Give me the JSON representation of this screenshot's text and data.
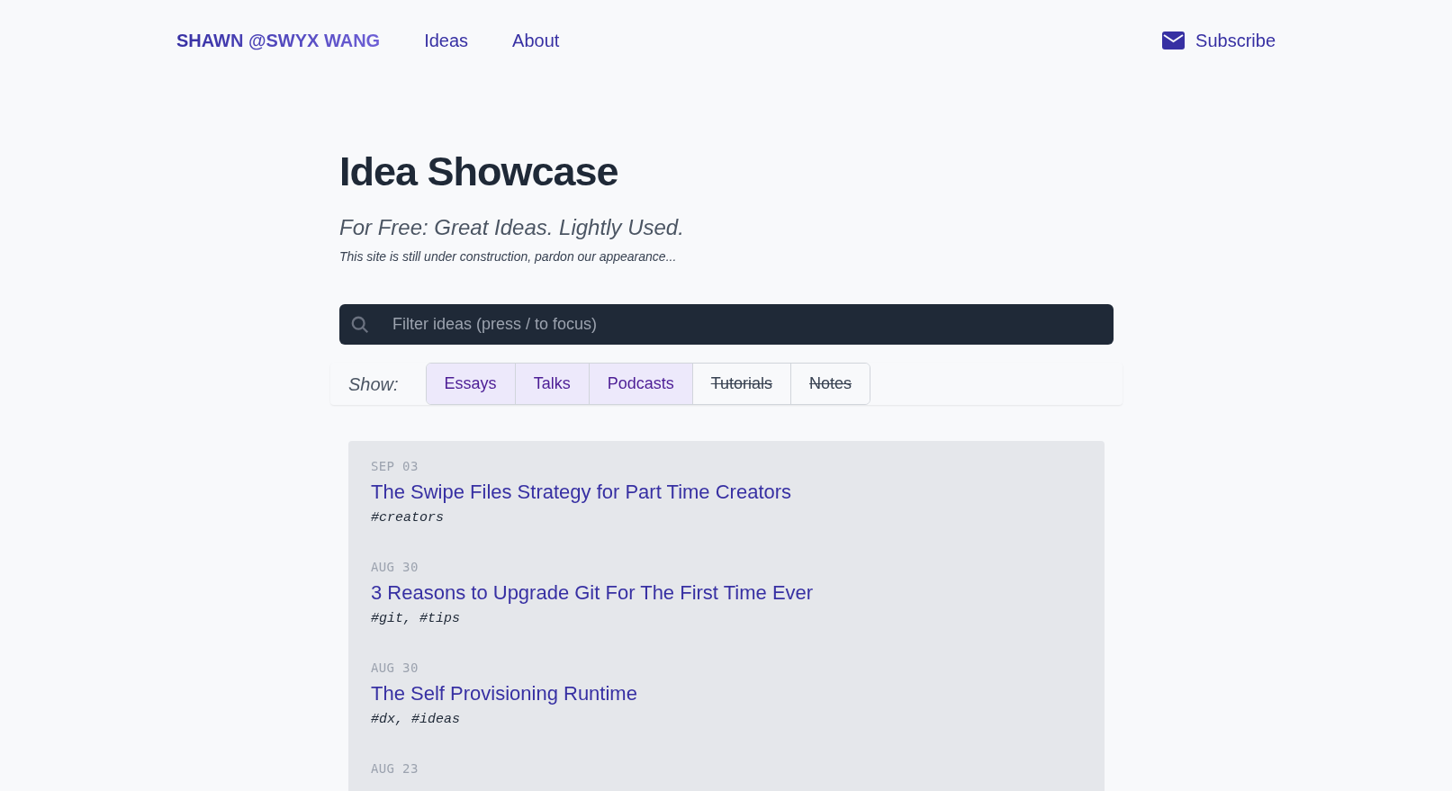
{
  "nav": {
    "logo": "SHAWN @SWYX WANG",
    "links": [
      "Ideas",
      "About"
    ],
    "subscribe": "Subscribe"
  },
  "header": {
    "title": "Idea Showcase",
    "subtitle": "For Free: Great Ideas. Lightly Used.",
    "note": "This site is still under construction, pardon our appearance..."
  },
  "search": {
    "placeholder": "Filter ideas (press / to focus)"
  },
  "filters": {
    "label": "Show:",
    "options": [
      {
        "label": "Essays",
        "selected": true
      },
      {
        "label": "Talks",
        "selected": true
      },
      {
        "label": "Podcasts",
        "selected": true
      },
      {
        "label": "Tutorials",
        "selected": false
      },
      {
        "label": "Notes",
        "selected": false
      }
    ]
  },
  "posts": [
    {
      "date": "SEP 03",
      "title": "The Swipe Files Strategy for Part Time Creators",
      "tags": "#creators"
    },
    {
      "date": "AUG 30",
      "title": "3 Reasons to Upgrade Git For The First Time Ever",
      "tags": "#git, #tips"
    },
    {
      "date": "AUG 30",
      "title": "The Self Provisioning Runtime",
      "tags": "#dx, #ideas"
    },
    {
      "date": "AUG 23"
    }
  ]
}
